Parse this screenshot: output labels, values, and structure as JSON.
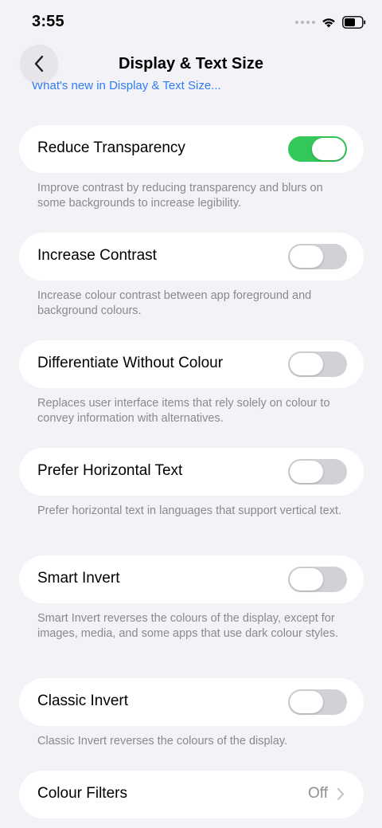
{
  "status": {
    "time": "3:55"
  },
  "nav": {
    "title": "Display & Text Size",
    "peek_link": "What's new in Display & Text Size..."
  },
  "settings": [
    {
      "label": "Reduce Transparency",
      "on": true,
      "desc": "Improve contrast by reducing transparency and blurs on some backgrounds to increase legibility."
    },
    {
      "label": "Increase Contrast",
      "on": false,
      "desc": "Increase colour contrast between app foreground and background colours."
    },
    {
      "label": "Differentiate Without Colour",
      "on": false,
      "desc": "Replaces user interface items that rely solely on colour to convey information with alternatives."
    },
    {
      "label": "Prefer Horizontal Text",
      "on": false,
      "desc": "Prefer horizontal text in languages that support vertical text."
    },
    {
      "label": "Smart Invert",
      "on": false,
      "desc": "Smart Invert reverses the colours of the display, except for images, media, and some apps that use dark colour styles."
    },
    {
      "label": "Classic Invert",
      "on": false,
      "desc": "Classic Invert reverses the colours of the display."
    }
  ],
  "colour_filters": {
    "label": "Colour Filters",
    "value": "Off"
  },
  "icons": [
    "back-chevron-icon",
    "chevron-right-icon",
    "wifi-icon",
    "battery-icon",
    "signal-icon"
  ],
  "colors": {
    "accent": "#34c759",
    "link": "#2f7cf6"
  }
}
